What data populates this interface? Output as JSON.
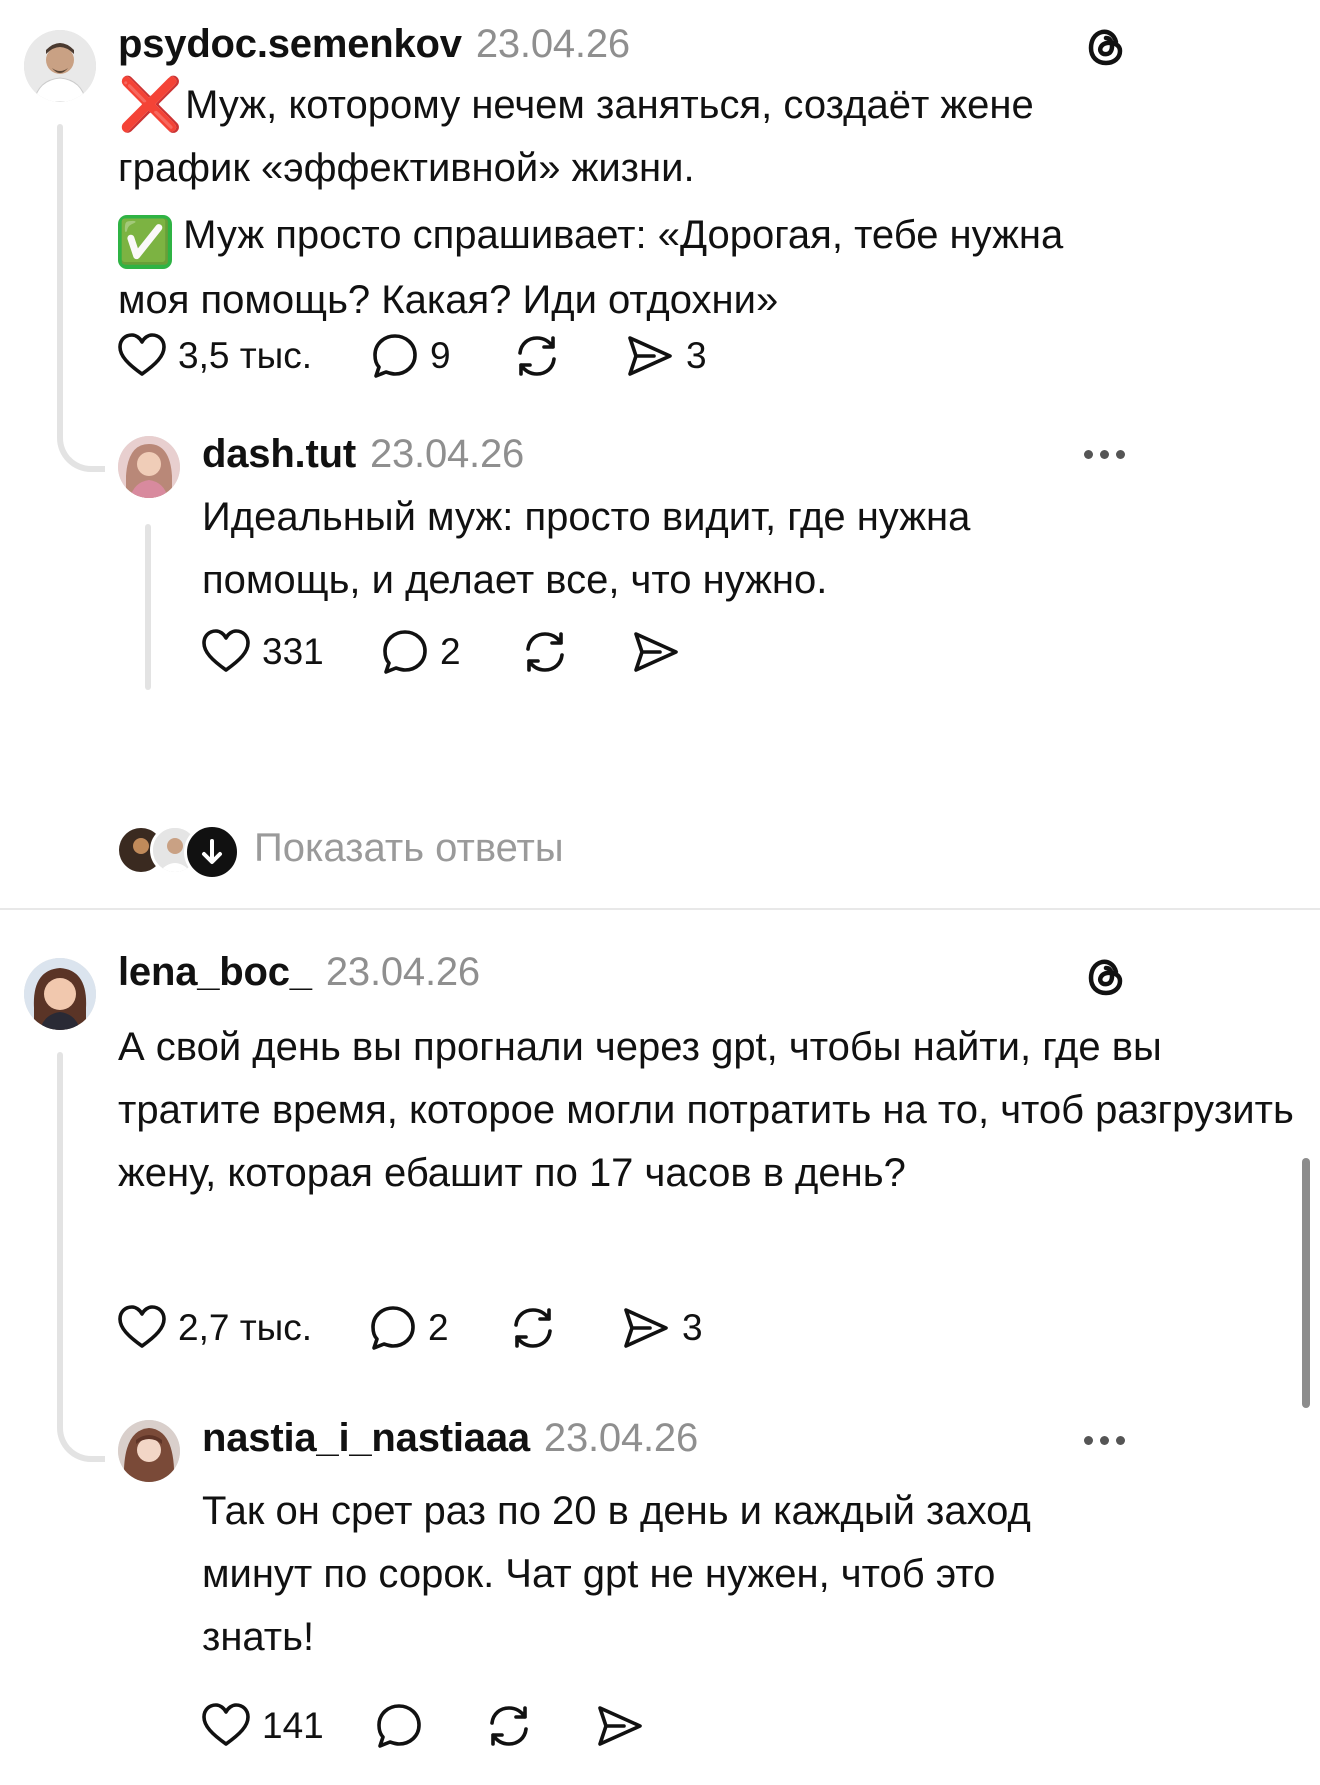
{
  "post1": {
    "username": "psydoc.semenkov",
    "date": "23.04.26",
    "line1": "Муж, которому нечем заняться, создаёт жене график «эффективной» жизни.",
    "line2": "Муж просто спрашивает: «Дорогая, тебе нужна моя помощь? Какая? Иди отдохни»",
    "likes": "3,5 тыс.",
    "comments": "9",
    "shares": "3",
    "emoji_bad": "❌",
    "emoji_good": "✅"
  },
  "reply1": {
    "username": "dash.tut",
    "date": "23.04.26",
    "text": "Идеальный муж: просто видит, где нужна помощь, и делает все, что нужно.",
    "likes": "331",
    "comments": "2"
  },
  "show_replies": "Показать ответы",
  "post2": {
    "username": "lena_boc_",
    "date": "23.04.26",
    "text": "А свой день вы прогнали через gpt, чтобы найти, где вы тратите время, которое могли потратить на то, чтоб разгрузить жену, которая ебашит по 17 часов в день?",
    "likes": "2,7 тыс.",
    "comments": "2",
    "shares": "3"
  },
  "reply2": {
    "username": "nastia_i_nastiaaa",
    "date": "23.04.26",
    "text": "Так он срет раз по 20 в день и каждый заход минут по сорок. Чат gpt не нужен, чтоб это знать!",
    "likes": "141"
  },
  "icons": {
    "like": "heart-icon",
    "comment": "comment-bubble-icon",
    "repost": "repost-icon",
    "share": "send-icon",
    "brand": "threads-logo-icon",
    "more": "more-options-icon"
  }
}
